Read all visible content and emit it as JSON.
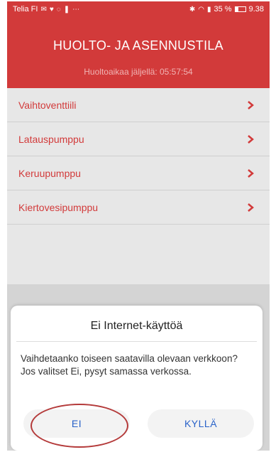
{
  "status_bar": {
    "carrier": "Telia FI",
    "battery_text": "35 %",
    "battery_level": 0.35,
    "time": "9.38"
  },
  "header": {
    "title": "HUOLTO- JA ASENNUSTILA",
    "subtitle": "Huoltoaikaa jäljellä: 05:57:54"
  },
  "menu": {
    "items": [
      {
        "label": "Vaihtoventtiili"
      },
      {
        "label": "Latauspumppu"
      },
      {
        "label": "Keruupumppu"
      },
      {
        "label": "Kiertovesipumppu"
      }
    ]
  },
  "dialog": {
    "title": "Ei Internet-käyttöä",
    "message": "Vaihdetaanko toiseen saatavilla olevaan verkkoon? Jos valitset Ei, pysyt samassa verkossa.",
    "no_label": "EI",
    "yes_label": "KYLLÄ"
  },
  "colors": {
    "brand_red": "#d23a3a",
    "link_blue": "#2a63c9"
  }
}
